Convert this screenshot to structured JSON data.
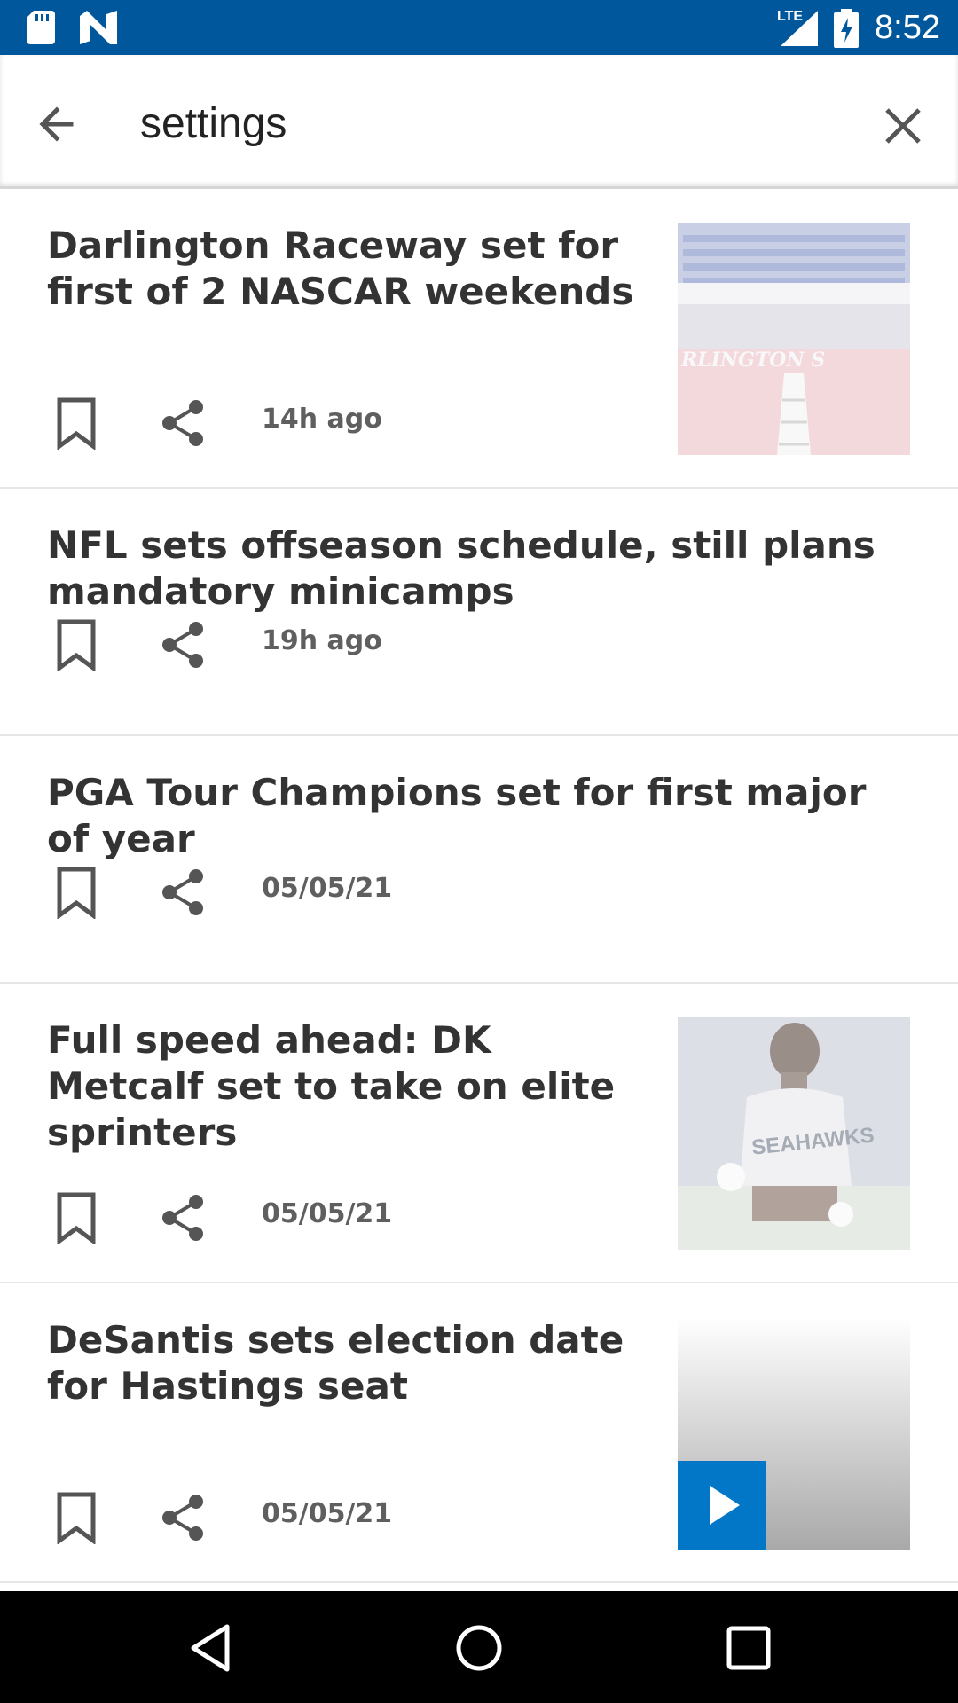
{
  "status_bar": {
    "time": "8:52",
    "network": "LTE",
    "icons": [
      "sd-card-icon",
      "news-app-icon",
      "lte-signal-icon",
      "battery-charging-icon"
    ]
  },
  "search": {
    "query": "settings",
    "back_icon": "arrow-back-icon",
    "clear_icon": "close-icon"
  },
  "results": [
    {
      "title": "Darlington Raceway set for first of 2 NASCAR weekends",
      "time": "14h ago",
      "thumbnail": "raceway-photo"
    },
    {
      "title": "NFL sets offseason schedule, still plans mandatory minicamps",
      "time": "19h ago",
      "thumbnail": null
    },
    {
      "title": "PGA Tour Champions set for first major of year",
      "time": "05/05/21",
      "thumbnail": null
    },
    {
      "title": "Full speed ahead: DK Metcalf set to take on elite sprinters",
      "time": "05/05/21",
      "thumbnail": "player-photo"
    },
    {
      "title": "DeSantis sets election date for Hastings seat",
      "time": "05/05/21",
      "thumbnail": "video-thumbnail"
    }
  ],
  "actions": {
    "bookmark_icon": "bookmark-icon",
    "share_icon": "share-icon"
  },
  "nav_bar": {
    "icons": [
      "back-triangle-icon",
      "home-circle-icon",
      "recents-square-icon"
    ]
  },
  "colors": {
    "status_bar": "#01579b",
    "play_button": "#0277c8",
    "text": "#333333",
    "date_text": "#5f5f5f"
  }
}
